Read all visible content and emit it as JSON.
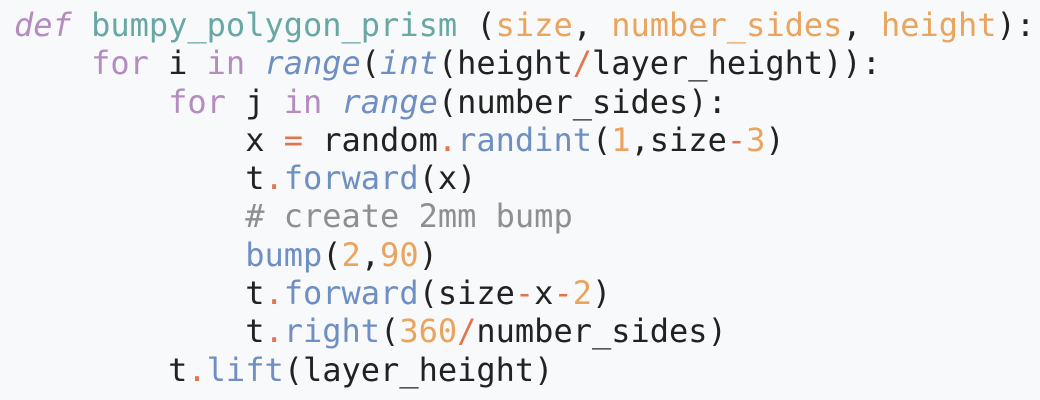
{
  "code": {
    "language": "python",
    "lines": [
      [
        {
          "t": "def",
          "c": "def"
        },
        {
          "t": " ",
          "c": "plain"
        },
        {
          "t": "bumpy_polygon_prism",
          "c": "fn"
        },
        {
          "t": " (",
          "c": "plain"
        },
        {
          "t": "size",
          "c": "param"
        },
        {
          "t": ", ",
          "c": "plain"
        },
        {
          "t": "number_sides",
          "c": "param"
        },
        {
          "t": ", ",
          "c": "plain"
        },
        {
          "t": "height",
          "c": "param"
        },
        {
          "t": "):",
          "c": "plain"
        }
      ],
      [
        {
          "t": "    ",
          "c": "plain"
        },
        {
          "t": "for",
          "c": "kw"
        },
        {
          "t": " i ",
          "c": "plain"
        },
        {
          "t": "in",
          "c": "kw"
        },
        {
          "t": " ",
          "c": "plain"
        },
        {
          "t": "range",
          "c": "bi"
        },
        {
          "t": "(",
          "c": "plain"
        },
        {
          "t": "int",
          "c": "bi"
        },
        {
          "t": "(height",
          "c": "plain"
        },
        {
          "t": "/",
          "c": "op"
        },
        {
          "t": "layer_height)):",
          "c": "plain"
        }
      ],
      [
        {
          "t": "        ",
          "c": "plain"
        },
        {
          "t": "for",
          "c": "kw"
        },
        {
          "t": " j ",
          "c": "plain"
        },
        {
          "t": "in",
          "c": "kw"
        },
        {
          "t": " ",
          "c": "plain"
        },
        {
          "t": "range",
          "c": "bi"
        },
        {
          "t": "(number_sides):",
          "c": "plain"
        }
      ],
      [
        {
          "t": "            x ",
          "c": "plain"
        },
        {
          "t": "=",
          "c": "op"
        },
        {
          "t": " random",
          "c": "plain"
        },
        {
          "t": ".",
          "c": "op"
        },
        {
          "t": "randint",
          "c": "meth"
        },
        {
          "t": "(",
          "c": "plain"
        },
        {
          "t": "1",
          "c": "num"
        },
        {
          "t": ",size",
          "c": "plain"
        },
        {
          "t": "-",
          "c": "op"
        },
        {
          "t": "3",
          "c": "num"
        },
        {
          "t": ")",
          "c": "plain"
        }
      ],
      [
        {
          "t": "            t",
          "c": "plain"
        },
        {
          "t": ".",
          "c": "op"
        },
        {
          "t": "forward",
          "c": "meth"
        },
        {
          "t": "(x)",
          "c": "plain"
        }
      ],
      [
        {
          "t": "            ",
          "c": "plain"
        },
        {
          "t": "# create 2mm bump",
          "c": "com"
        }
      ],
      [
        {
          "t": "            ",
          "c": "plain"
        },
        {
          "t": "bump",
          "c": "meth"
        },
        {
          "t": "(",
          "c": "plain"
        },
        {
          "t": "2",
          "c": "num"
        },
        {
          "t": ",",
          "c": "plain"
        },
        {
          "t": "90",
          "c": "num"
        },
        {
          "t": ")",
          "c": "plain"
        }
      ],
      [
        {
          "t": "            t",
          "c": "plain"
        },
        {
          "t": ".",
          "c": "op"
        },
        {
          "t": "forward",
          "c": "meth"
        },
        {
          "t": "(size",
          "c": "plain"
        },
        {
          "t": "-",
          "c": "op"
        },
        {
          "t": "x",
          "c": "plain"
        },
        {
          "t": "-",
          "c": "op"
        },
        {
          "t": "2",
          "c": "num"
        },
        {
          "t": ")",
          "c": "plain"
        }
      ],
      [
        {
          "t": "            t",
          "c": "plain"
        },
        {
          "t": ".",
          "c": "op"
        },
        {
          "t": "right",
          "c": "meth"
        },
        {
          "t": "(",
          "c": "plain"
        },
        {
          "t": "360",
          "c": "num"
        },
        {
          "t": "/",
          "c": "op"
        },
        {
          "t": "number_sides)",
          "c": "plain"
        }
      ],
      [
        {
          "t": "        t",
          "c": "plain"
        },
        {
          "t": ".",
          "c": "op"
        },
        {
          "t": "lift",
          "c": "meth"
        },
        {
          "t": "(layer_height)",
          "c": "plain"
        }
      ]
    ]
  },
  "colors": {
    "background": "#f8f9fa",
    "keyword": "#b58cc0",
    "function_name": "#67a8a5",
    "parameter": "#e9a45d",
    "number": "#e9a45d",
    "operator": "#e2754e",
    "builtin": "#6f8fc3",
    "method": "#6f8fc3",
    "comment": "#8f8f8f",
    "text": "#222222"
  }
}
